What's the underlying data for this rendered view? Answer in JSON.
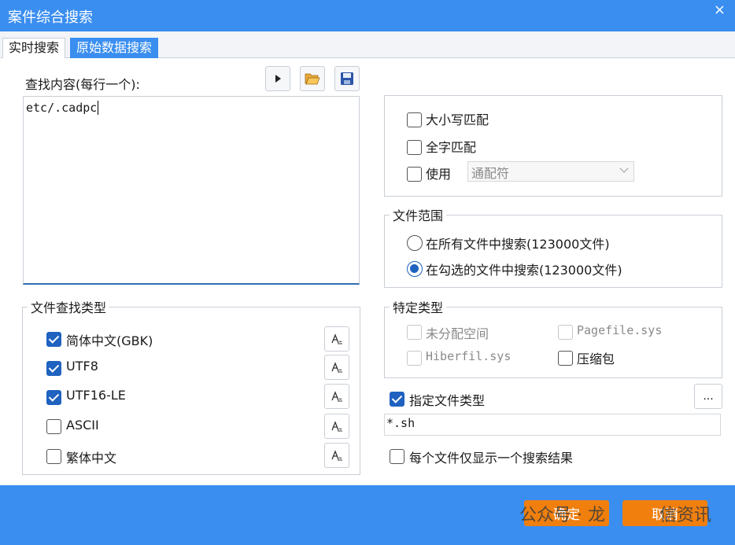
{
  "window": {
    "title": "案件综合搜索",
    "close_glyph": "×"
  },
  "tabs": [
    {
      "label": "实时搜索",
      "active": false
    },
    {
      "label": "原始数据搜索",
      "active": true
    }
  ],
  "search": {
    "label": "查找内容(每行一个):",
    "value": "etc/.cadpc"
  },
  "match_options": {
    "case": {
      "label": "大小写匹配",
      "checked": false
    },
    "whole_word": {
      "label": "全字匹配",
      "checked": false
    },
    "use": {
      "label": "使用",
      "checked": false,
      "selected": "通配符"
    }
  },
  "file_scope": {
    "title": "文件范围",
    "options": [
      {
        "label": "在所有文件中搜索(123000文件)",
        "checked": false
      },
      {
        "label": "在勾选的文件中搜索(123000文件)",
        "checked": true
      }
    ]
  },
  "file_types": {
    "title": "文件查找类型",
    "items": [
      {
        "label": "简体中文(GBK)",
        "checked": true
      },
      {
        "label": "UTF8",
        "checked": true
      },
      {
        "label": "UTF16-LE",
        "checked": true
      },
      {
        "label": "ASCII",
        "checked": false
      },
      {
        "label": "繁体中文",
        "checked": false
      }
    ]
  },
  "special_types": {
    "title": "特定类型",
    "unallocated": {
      "label": "未分配空间",
      "checked": false,
      "disabled": true
    },
    "pagefile": {
      "label": "Pagefile.sys",
      "checked": false,
      "disabled": true
    },
    "hiberfil": {
      "label": "Hiberfil.sys",
      "checked": false,
      "disabled": true
    },
    "archive": {
      "label": "压缩包",
      "checked": false,
      "disabled": false
    }
  },
  "specify_type": {
    "label": "指定文件类型",
    "checked": true,
    "value": "*.sh",
    "browse_label": "..."
  },
  "one_result": {
    "label": "每个文件仅显示一个搜索结果",
    "checked": false
  },
  "footer": {
    "ok_label": "确定",
    "cancel_label": "取消",
    "watermark_left": "公众号 · 龙",
    "watermark_right": "信资讯"
  },
  "colors": {
    "accent": "#3a8ef0",
    "check": "#1f62c0",
    "button": "#f07f0e"
  }
}
